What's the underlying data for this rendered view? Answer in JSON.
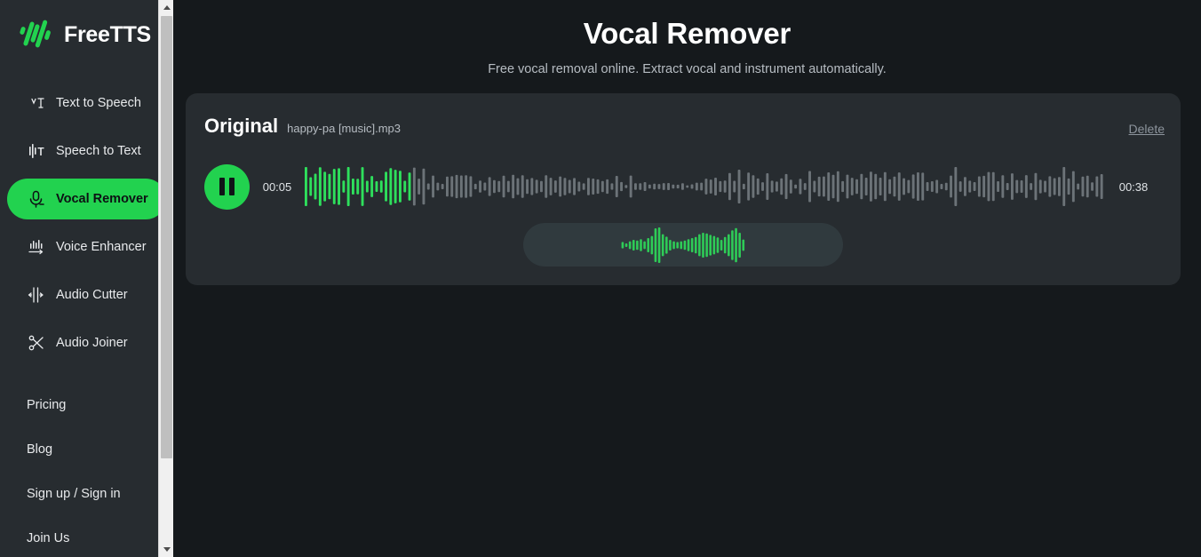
{
  "brand": {
    "name": "FreeTTS",
    "logo_icon": "freetts-waveform-logo",
    "accent": "#22d24f"
  },
  "sidebar": {
    "nav": [
      {
        "label": "Text to Speech",
        "icon": "text-to-speech-icon",
        "active": false
      },
      {
        "label": "Speech to Text",
        "icon": "speech-to-text-icon",
        "active": false
      },
      {
        "label": "Vocal Remover",
        "icon": "microphone-icon",
        "active": true
      },
      {
        "label": "Voice Enhancer",
        "icon": "voice-enhancer-icon",
        "active": false
      },
      {
        "label": "Audio Cutter",
        "icon": "audio-cutter-icon",
        "active": false
      },
      {
        "label": "Audio Joiner",
        "icon": "scissors-icon",
        "active": false
      }
    ],
    "links": [
      {
        "label": "Pricing"
      },
      {
        "label": "Blog"
      },
      {
        "label": "Sign up / Sign in"
      },
      {
        "label": "Join Us"
      }
    ],
    "scrollbar": {
      "up_icon": "scroll-up-arrow-icon",
      "down_icon": "scroll-down-arrow-icon"
    }
  },
  "header": {
    "title": "Vocal Remover",
    "subtitle": "Free vocal removal online. Extract vocal and instrument automatically."
  },
  "card": {
    "title": "Original",
    "filename": "happy-pa [music].mp3",
    "delete_label": "Delete",
    "player": {
      "state": "playing",
      "play_icon": "pause-icon",
      "current_time": "00:05",
      "duration": "00:38",
      "progress_percent": 13,
      "waveform_played_color": "#2ee05c",
      "waveform_remaining_color": "#6c7378"
    },
    "preview": {
      "icon": "preview-waveform-icon",
      "waveform_color": "#2ecc57",
      "background": "#303a3e"
    }
  }
}
